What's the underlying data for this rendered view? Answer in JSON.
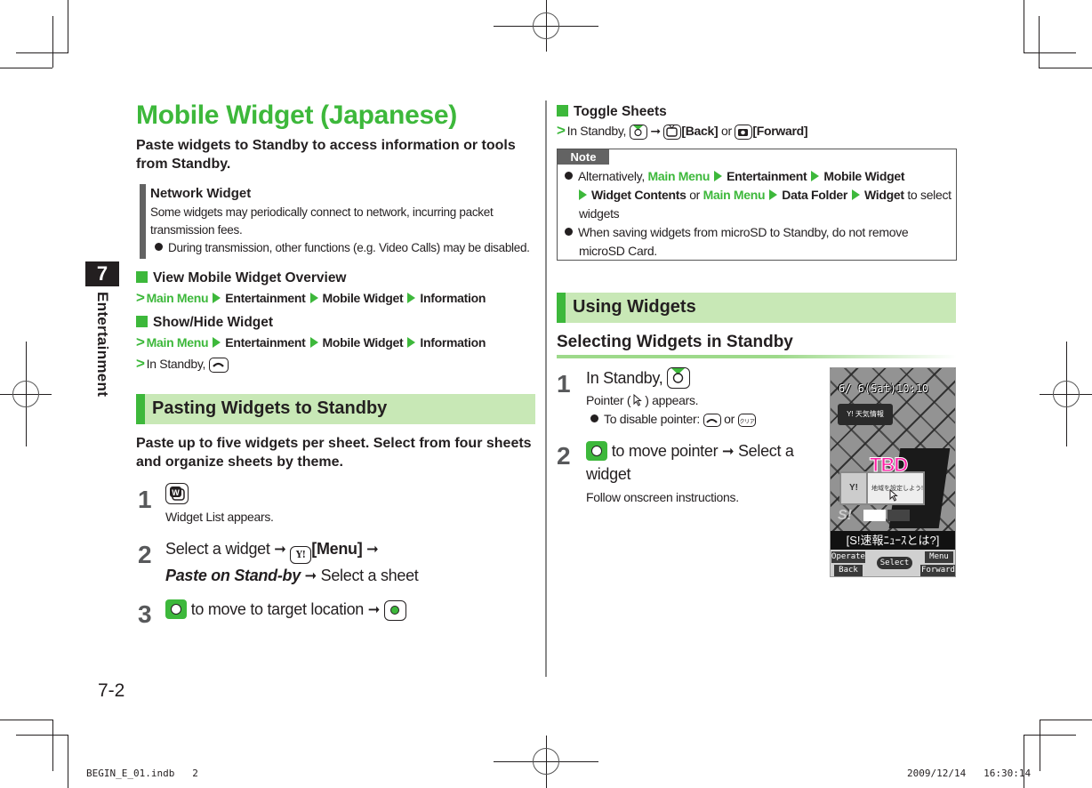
{
  "title": "Mobile Widget (Japanese)",
  "lead": "Paste widgets to Standby to access information or tools from Standby.",
  "network_widget": {
    "heading": "Network Widget",
    "body": "Some widgets may periodically connect to network, incurring packet transmission fees.",
    "bullet": "During transmission, other functions (e.g. Video Calls) may be disabled."
  },
  "chapter": {
    "number": "7",
    "label": "Entertainment"
  },
  "view_overview": {
    "heading": "View Mobile Widget Overview",
    "path": [
      "Main Menu",
      "Entertainment",
      "Mobile Widget",
      "Information"
    ]
  },
  "show_hide": {
    "heading": "Show/Hide Widget",
    "path": [
      "Main Menu",
      "Entertainment",
      "Mobile Widget",
      "Information"
    ],
    "alt_prefix": "In Standby,"
  },
  "pasting": {
    "section_title": "Pasting Widgets to Standby",
    "intro": "Paste up to five widgets per sheet. Select from four sheets and organize sheets by theme.",
    "steps": [
      {
        "num": "1",
        "sub": "Widget List appears."
      },
      {
        "num": "2",
        "text_a": "Select a widget",
        "menu_label": "[Menu]",
        "italic": "Paste on Stand-by",
        "text_b": "Select a sheet"
      },
      {
        "num": "3",
        "text": "to move to target location"
      }
    ]
  },
  "toggle": {
    "heading": "Toggle Sheets",
    "prefix": "In Standby,",
    "back_label": "[Back]",
    "or": "or",
    "forward_label": "[Forward]"
  },
  "note": {
    "tab": "Note",
    "items": [
      {
        "alt": "Alternatively,",
        "main_menu": "Main Menu",
        "p1": "Entertainment",
        "p2": "Mobile Widget",
        "p3": "Widget Contents",
        "or": "or",
        "main_menu2": "Main Menu",
        "p4": "Data Folder",
        "p5": "Widget",
        "suffix": "to select widgets"
      },
      {
        "text": "When saving widgets from microSD to Standby, do not remove microSD Card."
      }
    ]
  },
  "using": {
    "section_title": "Using Widgets",
    "subsection": "Selecting Widgets in Standby",
    "steps": [
      {
        "num": "1",
        "text": "In Standby,",
        "sub": "Pointer (",
        "sub_end": ") appears.",
        "bullet": "To disable pointer:",
        "or": "or"
      },
      {
        "num": "2",
        "text": "to move pointer",
        "text_b": "Select a widget",
        "sub": "Follow onscreen instructions."
      }
    ]
  },
  "phone_screen": {
    "time": "6/ 6(Sat)10:10",
    "weather_widget": "Y! 天気情報",
    "tbd": "TBD",
    "y_logo": "Y!",
    "y_text": "地域を設定しよう!",
    "s1": "S!",
    "news": "[S!速報ﾆｭｰｽとは?]",
    "softkeys": {
      "operate": "Operate",
      "back": "Back",
      "select": "Select",
      "menu": "Menu",
      "forward": "Forward"
    }
  },
  "arrow": "➞",
  "page_number": "7-2",
  "slug": {
    "file": "BEGIN_E_01.indb   2",
    "timestamp": "2009/12/14   16:30:14"
  }
}
